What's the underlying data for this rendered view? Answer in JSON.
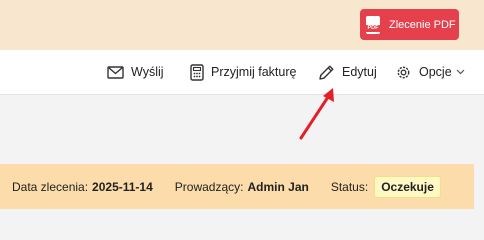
{
  "header": {
    "pdf_button_label": "Zlecenie PDF",
    "pdf_icon_text": "PDF"
  },
  "toolbar": {
    "send_label": "Wyślij",
    "accept_invoice_label": "Przyjmij fakturę",
    "edit_label": "Edytuj",
    "options_label": "Opcje"
  },
  "status": {
    "order_date_label": "Data zlecenia:",
    "order_date_value": "2025-11-14",
    "manager_label": "Prowadzący:",
    "manager_value": "Admin Jan",
    "status_label": "Status:",
    "status_value": "Oczekuje"
  },
  "colors": {
    "pdf_button": "#e4414d",
    "header_bg": "#f8e6cf",
    "status_bar_bg": "#fbdcaa",
    "badge_bg": "#fff8c4",
    "arrow": "#e3202a"
  }
}
